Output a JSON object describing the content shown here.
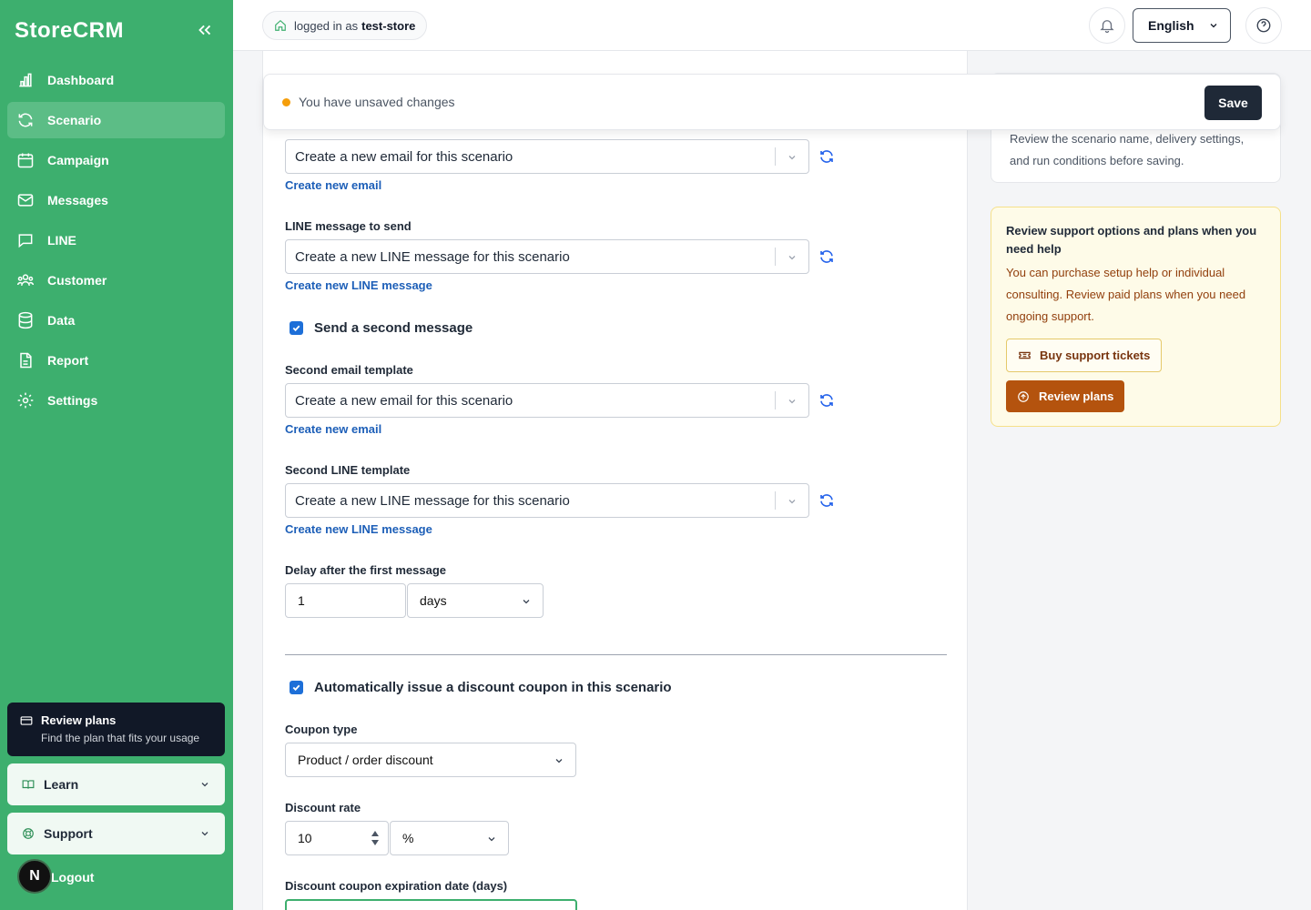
{
  "brand": "StoreCRM",
  "nav": [
    {
      "label": "Dashboard",
      "icon": "chart-bar-icon"
    },
    {
      "label": "Scenario",
      "icon": "refresh-icon"
    },
    {
      "label": "Campaign",
      "icon": "calendar-icon"
    },
    {
      "label": "Messages",
      "icon": "mail-icon"
    },
    {
      "label": "LINE",
      "icon": "chat-bubble-icon"
    },
    {
      "label": "Customer",
      "icon": "users-icon"
    },
    {
      "label": "Data",
      "icon": "database-icon"
    },
    {
      "label": "Report",
      "icon": "file-icon"
    },
    {
      "label": "Settings",
      "icon": "gear-icon"
    }
  ],
  "sidebar_footer": {
    "plan_title": "Review plans",
    "plan_sub": "Find the plan that fits your usage",
    "learn": "Learn",
    "support": "Support",
    "logout": "Logout",
    "avatar_letter": "N"
  },
  "header": {
    "login_prefix": "logged in as",
    "store": "test-store",
    "language": "English"
  },
  "unsaved": {
    "text": "You have unsaved changes",
    "save": "Save"
  },
  "form": {
    "first_email_select": "Create a new email for this scenario",
    "first_email_link": "Create new email",
    "line_label": "LINE message to send",
    "line_select": "Create a new LINE message for this scenario",
    "line_link": "Create new LINE message",
    "second_message_check": "Send a second message",
    "second_email_label": "Second email template",
    "second_email_select": "Create a new email for this scenario",
    "second_email_link": "Create new email",
    "second_line_label": "Second LINE template",
    "second_line_select": "Create a new LINE message for this scenario",
    "second_line_link": "Create new LINE message",
    "delay_label": "Delay after the first message",
    "delay_value": "1",
    "delay_unit": "days",
    "coupon_check": "Automatically issue a discount coupon in this scenario",
    "coupon_type_label": "Coupon type",
    "coupon_type_value": "Product / order discount",
    "discount_rate_label": "Discount rate",
    "discount_rate_value": "10",
    "discount_unit": "%",
    "expiration_label": "Discount coupon expiration date (days)"
  },
  "info_card": {
    "text": "Review the scenario name, delivery settings, and run conditions before saving."
  },
  "support_card": {
    "title": "Review support options and plans when you need help",
    "body": "You can purchase setup help or individual consulting. Review paid plans when you need ongoing support.",
    "ticket_button": "Buy support tickets",
    "plans_button": "Review plans"
  }
}
